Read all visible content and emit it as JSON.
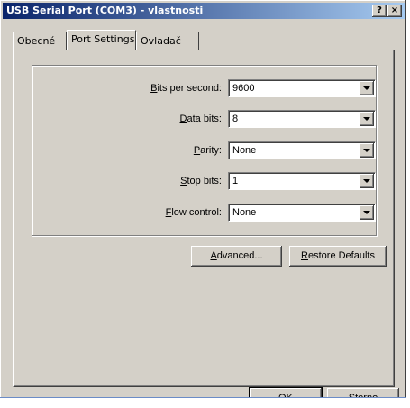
{
  "window": {
    "title": "USB Serial Port (COM3) - vlastnosti",
    "help_label": "?",
    "close_label": "×"
  },
  "tabs": [
    {
      "label": "Obecné",
      "active": false
    },
    {
      "label": "Port Settings",
      "active": true
    },
    {
      "label": "Ovladač",
      "active": false
    }
  ],
  "settings": {
    "bits_per_second": {
      "mnemonic": "B",
      "label_rest": "its per second:",
      "value": "9600"
    },
    "data_bits": {
      "mnemonic": "D",
      "label_rest": "ata bits:",
      "value": "8"
    },
    "parity": {
      "mnemonic": "P",
      "label_rest": "arity:",
      "value": "None"
    },
    "stop_bits": {
      "mnemonic": "S",
      "label_rest": "top bits:",
      "value": "1"
    },
    "flow_control": {
      "mnemonic": "F",
      "label_rest": "low control:",
      "value": "None"
    }
  },
  "buttons": {
    "advanced": {
      "mnemonic": "A",
      "rest": "dvanced..."
    },
    "restore": {
      "mnemonic": "R",
      "rest": "estore Defaults"
    },
    "ok": "OK",
    "cancel": "Storno"
  }
}
